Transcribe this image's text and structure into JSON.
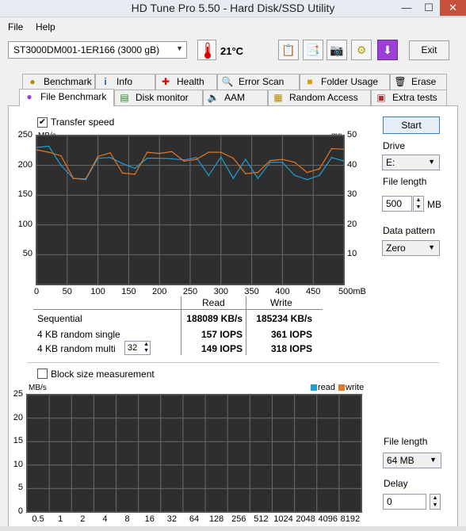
{
  "window": {
    "title": "HD Tune Pro 5.50 - Hard Disk/SSD Utility",
    "min": "—",
    "max": "☐",
    "close": "✕"
  },
  "menu": {
    "file": "File",
    "help": "Help"
  },
  "toolbar": {
    "drive": "ST3000DM001-1ER166 (3000 gB)",
    "temperature": "21°C",
    "exit": "Exit"
  },
  "tabs_row1": [
    {
      "label": "Benchmark"
    },
    {
      "label": "Info"
    },
    {
      "label": "Health"
    },
    {
      "label": "Error Scan"
    },
    {
      "label": "Folder Usage"
    },
    {
      "label": "Erase"
    }
  ],
  "tabs_row2": [
    {
      "label": "File Benchmark"
    },
    {
      "label": "Disk monitor"
    },
    {
      "label": "AAM"
    },
    {
      "label": "Random Access"
    },
    {
      "label": "Extra tests"
    }
  ],
  "transfer": {
    "checkbox_label": "Transfer speed",
    "checked": true,
    "unit_left": "MB/s",
    "unit_right": "ms"
  },
  "chart_data": [
    {
      "type": "line",
      "title": "",
      "xlabel": "",
      "ylabel": "MB/s",
      "y2label": "ms",
      "xlim": [
        0,
        500
      ],
      "ylim": [
        0,
        250
      ],
      "y2lim": [
        0,
        50
      ],
      "x_ticks": [
        "0",
        "50",
        "100",
        "150",
        "200",
        "250",
        "300",
        "350",
        "400",
        "450",
        "500mB"
      ],
      "y_ticks": [
        "250",
        "200",
        "150",
        "100",
        "50"
      ],
      "y2_ticks": [
        "50",
        "40",
        "30",
        "20",
        "10"
      ],
      "grid": true,
      "x": [
        0,
        20,
        40,
        60,
        80,
        100,
        120,
        140,
        160,
        180,
        200,
        220,
        240,
        260,
        280,
        300,
        320,
        340,
        360,
        380,
        400,
        420,
        440,
        460,
        480,
        500
      ],
      "series": [
        {
          "name": "read",
          "values": [
            230,
            232,
            200,
            178,
            176,
            212,
            213,
            203,
            195,
            212,
            212,
            211,
            209,
            213,
            183,
            214,
            178,
            210,
            178,
            205,
            205,
            183,
            176,
            183,
            213,
            207
          ]
        },
        {
          "name": "write",
          "values": [
            226,
            222,
            216,
            178,
            177,
            215,
            221,
            187,
            185,
            222,
            220,
            223,
            207,
            210,
            222,
            222,
            212,
            186,
            188,
            208,
            210,
            205,
            188,
            194,
            228,
            227
          ]
        }
      ]
    },
    {
      "type": "bar",
      "title": "",
      "ylabel": "MB/s",
      "ylim": [
        0,
        25
      ],
      "y_ticks": [
        "25",
        "20",
        "15",
        "10",
        "5",
        "0"
      ],
      "categories": [
        "0.5",
        "1",
        "2",
        "4",
        "8",
        "16",
        "32",
        "64",
        "128",
        "256",
        "512",
        "1024",
        "2048",
        "4096",
        "8192"
      ],
      "series": [
        {
          "name": "read",
          "values": []
        },
        {
          "name": "write",
          "values": []
        }
      ],
      "grid": true
    }
  ],
  "results": {
    "col_read": "Read",
    "col_write": "Write",
    "rows": [
      {
        "label": "Sequential",
        "read": "188089 KB/s",
        "write": "185234 KB/s"
      },
      {
        "label": "4 KB random single",
        "read": "157 IOPS",
        "write": "361 IOPS"
      },
      {
        "label": "4 KB random multi",
        "read": "149 IOPS",
        "write": "318 IOPS"
      }
    ],
    "multi_value": "32"
  },
  "controls": {
    "start": "Start",
    "drive_label": "Drive",
    "drive_value": "E:",
    "file_length_label": "File length",
    "file_length_value": "500",
    "file_length_unit": "MB",
    "data_pattern_label": "Data pattern",
    "data_pattern_value": "Zero"
  },
  "block": {
    "checkbox_label": "Block size measurement",
    "checked": false,
    "unit": "MB/s",
    "legend_read": "read",
    "legend_write": "write",
    "file_length_label": "File length",
    "file_length_value": "64 MB",
    "delay_label": "Delay",
    "delay_value": "0"
  },
  "colors": {
    "read": "#1e9fd6",
    "write": "#e8761c",
    "chart_bg": "#2e2e2e",
    "grid": "#6a6a6a"
  }
}
